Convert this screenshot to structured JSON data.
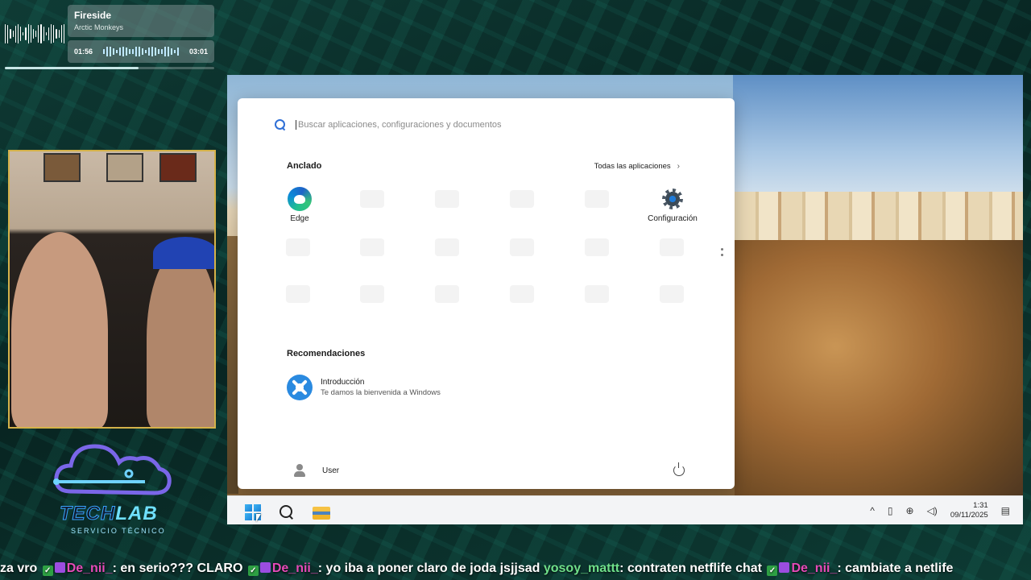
{
  "music": {
    "title": "Fireside",
    "artist": "Arctic Monkeys",
    "elapsed": "01:56",
    "duration": "03:01",
    "progress": 0.64
  },
  "logo": {
    "tech": "TECH",
    "lab": "LAB",
    "subtitle": "SERVICIO TÉCNICO"
  },
  "start_menu": {
    "search_placeholder": "Buscar aplicaciones, configuraciones y documentos",
    "pinned_title": "Anclado",
    "all_apps_label": "Todas las aplicaciones",
    "pinned_apps": [
      {
        "label": "Edge",
        "icon": "edge-icon"
      },
      {
        "label": "Configuración",
        "icon": "gear-icon"
      }
    ],
    "recommendations_title": "Recomendaciones",
    "recommendation": {
      "title": "Introducción",
      "subtitle": "Te damos la bienvenida a Windows",
      "icon": "get-started-icon"
    },
    "user_label": "User"
  },
  "taskbar": {
    "time": "1:31",
    "date": "09/11/2025"
  },
  "chat": [
    {
      "text": "za vro ",
      "user": ""
    },
    {
      "user": "De_nii_",
      "text": ": en serio??? CLARO "
    },
    {
      "user": "De_nii_",
      "text": ": yo iba a poner claro de joda jsjjsad "
    },
    {
      "user": "yosoy_mattt",
      "text": ": contraten netflife chat "
    },
    {
      "user": "De_nii_",
      "text": ": cambiate a netlife"
    }
  ],
  "colors": {
    "accent": "#2f6fd6",
    "chat_user_pink": "#e64bb9",
    "chat_user_green": "#6fe08a"
  }
}
